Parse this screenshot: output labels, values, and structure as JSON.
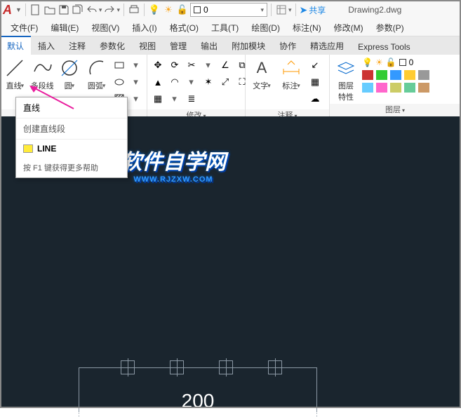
{
  "app": {
    "logo": "A",
    "filename": "Drawing2.dwg",
    "share": "共享"
  },
  "qat": {
    "layer_current": "0"
  },
  "menubar": [
    "文件(F)",
    "编辑(E)",
    "视图(V)",
    "插入(I)",
    "格式(O)",
    "工具(T)",
    "绘图(D)",
    "标注(N)",
    "修改(M)",
    "参数(P)"
  ],
  "tabs": [
    "默认",
    "插入",
    "注释",
    "参数化",
    "视图",
    "管理",
    "输出",
    "附加模块",
    "协作",
    "精选应用",
    "Express Tools"
  ],
  "ribbon": {
    "draw": {
      "line": "直线",
      "polyline": "多段线",
      "circle": "圆",
      "arc": "圆弧"
    },
    "modify": {
      "label": "修改"
    },
    "annot": {
      "text": "文字",
      "dim": "标注",
      "label": "注释"
    },
    "layer": {
      "btn": "图层\n特性",
      "label": "图层",
      "current": "0"
    }
  },
  "tooltip": {
    "title": "直线",
    "desc": "创建直线段",
    "cmd": "LINE",
    "help": "按 F1 键获得更多帮助"
  },
  "watermark": {
    "text": "软件自学网",
    "url": "WWW.RJZXW.COM"
  },
  "chart_data": {
    "type": "dimension",
    "value": 200,
    "markers": 4,
    "marker_spacing_approx": 66.7
  }
}
